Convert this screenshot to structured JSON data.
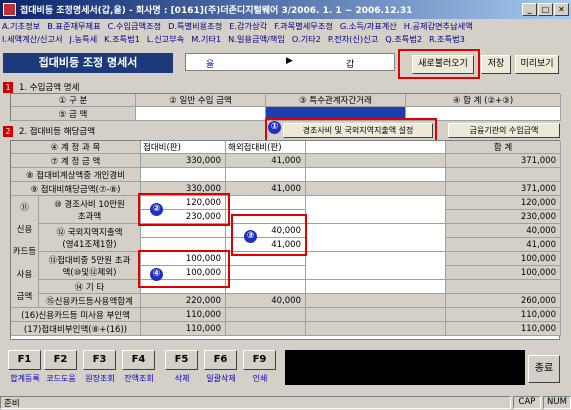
{
  "window": {
    "title": "접대비등 조정명세서(갑,을) - 회사명 : [0161](주)더존디지털웨어 3/2006. 1. 1 ~ 2006.12.31"
  },
  "menu": {
    "row1": [
      "A.기초정보",
      "B.표준재무제표",
      "C.수입금액조정",
      "D.특별비용조정",
      "E.감가상각",
      "F.과목별세무조정",
      "G.소득/과표계산",
      "H.공제감면추납세액"
    ],
    "row2": [
      "I.세액계산/신고서",
      "J.농특세",
      "K.조특법1",
      "L.신고부속",
      "M.기타1",
      "N.일용금액/책임",
      "O.기타2",
      "P.전자(신)신고",
      "Q.조특법2",
      "R.조특법3"
    ]
  },
  "tabbar": {
    "title": "접대비등 조정 명세서",
    "period_from": "을",
    "arrow": "▶",
    "period_to": "갑",
    "btn_reload": "새로불러오기",
    "btn_save": "저장",
    "btn_preview": "미리보기"
  },
  "section1": {
    "num": "1",
    "label": "1. 수입금액 명세",
    "headers": [
      "① 구  분",
      "② 일반 수입 금액",
      "③ 특수관계자간거래",
      "④ 합 계 (②+③)"
    ],
    "row_label": "⑤ 금  액"
  },
  "section2": {
    "num": "2",
    "label": "2. 접대비등 해당금액",
    "btn_special": "경조사비 및 국외지역지출액 설정",
    "btn_finance": "금융기관의 수입금액",
    "headers": [
      "④ 계 정 과 목",
      "접대비(판)",
      "해외접대비(판)",
      "합  계"
    ],
    "rows": [
      {
        "label": "⑦ 계 정 금 액",
        "v1": "330,000",
        "v2": "41,000",
        "total": "371,000"
      },
      {
        "label": "⑧ 접대비계상액중 개인경비",
        "v1": "",
        "v2": "",
        "total": ""
      },
      {
        "label": "⑨ 접대비해당금액(⑦-⑧)",
        "v1": "330,000",
        "v2": "41,000",
        "total": "371,000"
      }
    ],
    "side_label_1": "⑪",
    "side_label_2": "신용",
    "side_label_3": "카드등",
    "side_label_4": "사용",
    "side_label_5": "금액",
    "sub_rows": [
      {
        "label_a": "⑩ 경조사비 10만원",
        "label_b": "초과액",
        "v1a": "120,000",
        "v1b": "230,000",
        "v2a": "",
        "v2b": "",
        "ta": "120,000",
        "tb": "230,000"
      },
      {
        "label_a": "⑫ 국외지역지출액",
        "label_b": "(영41조제1항)",
        "v1a": "",
        "v1b": "",
        "v2a": "40,000",
        "v2b": "41,000",
        "ta": "40,000",
        "tb": "41,000"
      },
      {
        "label_a": "⑬접대비중 5만원 초과",
        "label_b": "액(⑩및⑫제외)",
        "v1a": "100,000",
        "v1b": "100,000",
        "v2a": "",
        "v2b": "",
        "ta": "100,000",
        "tb": "100,000"
      }
    ],
    "row_other": {
      "label": "⑭ 기  타",
      "v1": "",
      "v2": "",
      "total": ""
    },
    "row_cardsum": {
      "label": "⑮신용카드등사용액합계",
      "v1": "220,000",
      "v2": "40,000",
      "total": "260,000"
    },
    "row_nouse": {
      "label": "(16)신용카드등 미사용 부인액",
      "v1": "110,000",
      "v2": "",
      "total": "110,000"
    },
    "row_deny": {
      "label": "(17)접대비부인액(⑧+(16))",
      "v1": "110,000",
      "v2": "",
      "total": "110,000"
    }
  },
  "annotations": [
    "①",
    "②",
    "③",
    "④"
  ],
  "fkeys": [
    {
      "key": "F1",
      "label": "합계등록"
    },
    {
      "key": "F2",
      "label": "코드도움"
    },
    {
      "key": "F3",
      "label": "원장조회"
    },
    {
      "key": "F4",
      "label": "잔액조회"
    },
    {
      "key": "F5",
      "label": "삭제"
    },
    {
      "key": "F6",
      "label": "일괄삭제"
    },
    {
      "key": "F9",
      "label": "인쇄"
    }
  ],
  "close_label": "종료",
  "status": {
    "left": "준비",
    "cap": "CAP",
    "num": "NUM"
  }
}
